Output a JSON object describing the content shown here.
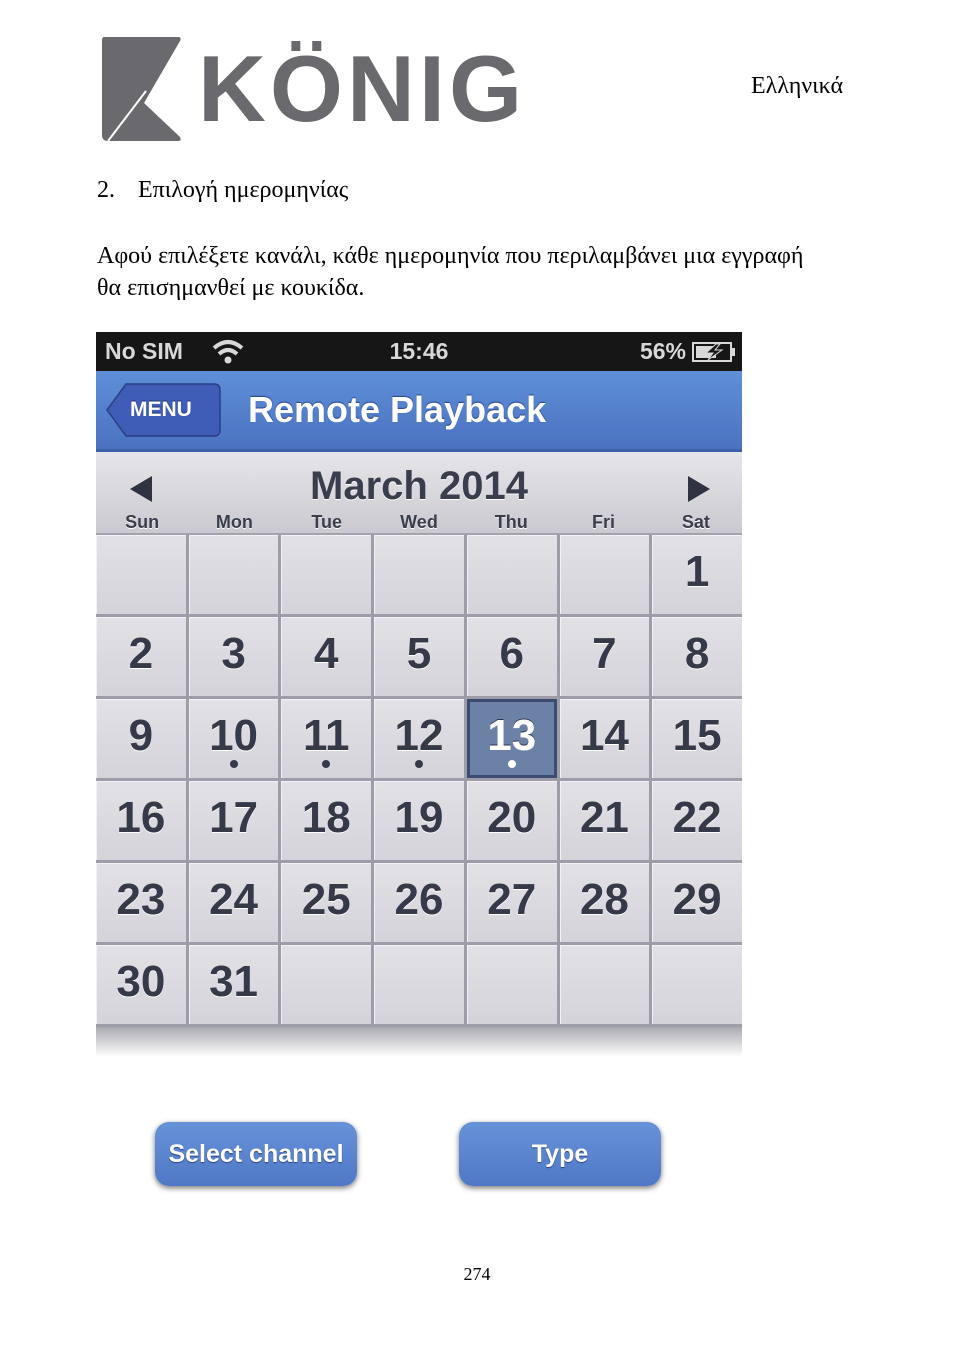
{
  "header": {
    "brand": "KÖNIG",
    "language": "Ελληνικά"
  },
  "section": {
    "number": "2.",
    "title": "Επιλογή ημερομηνίας",
    "paragraph": "Αφού επιλέξετε κανάλι, κάθε ημερομηνία που περιλαμβάνει μια εγγραφή θα επισημανθεί με κουκίδα."
  },
  "phone": {
    "status": {
      "carrier": "No SIM",
      "time": "15:46",
      "battery": "56%"
    },
    "nav": {
      "back_label": "MENU",
      "title": "Remote Playback"
    },
    "calendar": {
      "month_label": "March 2014",
      "weekdays": [
        "Sun",
        "Mon",
        "Tue",
        "Wed",
        "Thu",
        "Fri",
        "Sat"
      ],
      "first_weekday_index": 6,
      "days_in_month": 31,
      "selected_day": 13,
      "days_with_recordings": [
        10,
        11,
        12,
        13
      ],
      "rows": 6
    },
    "colors": {
      "accent": "#5a86d0",
      "selected": "#6b81a5"
    }
  },
  "buttons": {
    "select_channel": "Select channel",
    "type": "Type"
  },
  "footer": {
    "page_number": "274"
  }
}
